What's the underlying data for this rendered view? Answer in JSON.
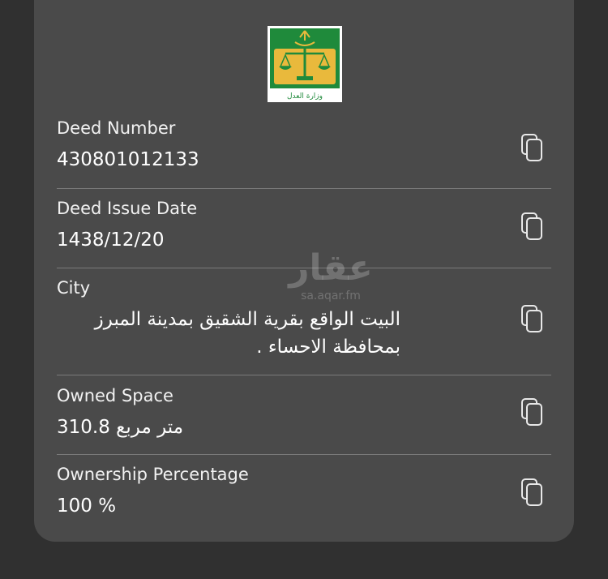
{
  "fields": [
    {
      "label": "Deed Number",
      "value": "430801012133"
    },
    {
      "label": "Deed Issue Date",
      "value": "1438/12/20"
    },
    {
      "label": "City",
      "value": "البيت الواقع بقرية الشقيق بمدينة المبرز بمحافظة الاحساء ."
    },
    {
      "label": "Owned Space",
      "value": "310.8 متر مربع"
    },
    {
      "label": "Ownership Percentage",
      "value": "100 %"
    }
  ],
  "logo": {
    "text": "وزارة العدل",
    "icon": "ministry-of-justice-logo",
    "colors": {
      "green": "#1f8a3b",
      "gold": "#e9b93c"
    }
  },
  "watermark": {
    "main": "عقار",
    "sub": "sa.aqar.fm"
  },
  "icons": {
    "copy": "copy-icon"
  }
}
